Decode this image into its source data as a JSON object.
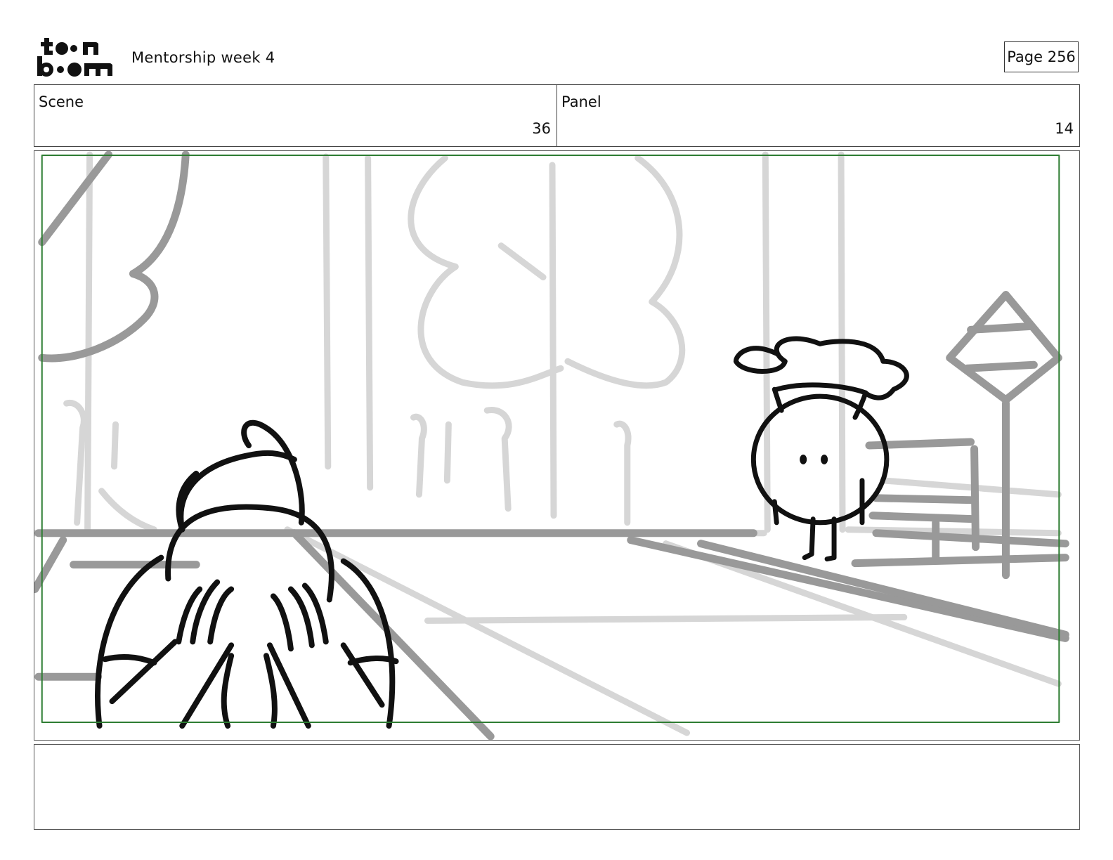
{
  "header": {
    "logo_text_top": "toon",
    "logo_text_bottom": "boom",
    "project_title": "Mentorship week 4",
    "page_label": "Page 256"
  },
  "info": {
    "scene_label": "Scene",
    "scene_value": "36",
    "panel_label": "Panel",
    "panel_value": "14"
  },
  "panel": {
    "safe_frame_color": "#2e7d32",
    "foreground_stroke": "#111111",
    "midground_stroke": "#999999",
    "background_stroke": "#d6d6d6"
  },
  "notes": {
    "text": ""
  }
}
